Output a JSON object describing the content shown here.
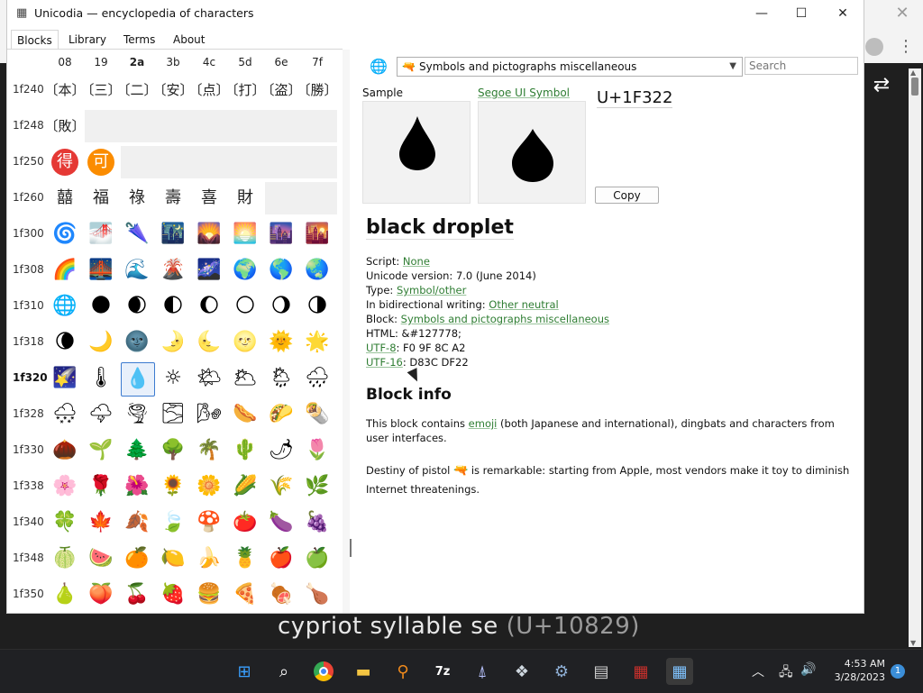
{
  "window": {
    "title": "Unicodia — encyclopedia of characters",
    "minimize": "—",
    "maximize": "☐",
    "close": "✕"
  },
  "tabs": [
    "Blocks",
    "Library",
    "Terms",
    "About"
  ],
  "grid": {
    "columns": [
      "08",
      "19",
      "2a",
      "3b",
      "4c",
      "5d",
      "6e",
      "7f"
    ],
    "rows": [
      {
        "label": "1f240",
        "cells": [
          "〔本〕",
          "〔三〕",
          "〔二〕",
          "〔安〕",
          "〔点〕",
          "〔打〕",
          "〔盗〕",
          "〔勝〕"
        ]
      },
      {
        "label": "1f248",
        "cells": [
          "〔敗〕"
        ]
      },
      {
        "label": "1f250",
        "cells": [
          "得",
          "可"
        ]
      },
      {
        "label": "1f260",
        "cells": [
          "囍",
          "福",
          "祿",
          "壽",
          "喜",
          "財"
        ]
      },
      {
        "label": "1f300",
        "cells": [
          "🌀",
          "🌁",
          "🌂",
          "🌃",
          "🌄",
          "🌅",
          "🌆",
          "🌇"
        ]
      },
      {
        "label": "1f308",
        "cells": [
          "🌈",
          "🌉",
          "🌊",
          "🌋",
          "🌌",
          "🌍",
          "🌎",
          "🌏"
        ]
      },
      {
        "label": "1f310",
        "cells": [
          "🌐",
          "🌑",
          "🌒",
          "🌓",
          "🌔",
          "🌕",
          "🌖",
          "🌗"
        ]
      },
      {
        "label": "1f318",
        "cells": [
          "🌘",
          "🌙",
          "🌚",
          "🌛",
          "🌜",
          "🌝",
          "🌞",
          "🌟"
        ]
      },
      {
        "label": "1f320",
        "cells": [
          "🌠",
          "🌡",
          "💧",
          "☼",
          "🌤",
          "🌥",
          "🌦",
          "🌧"
        ]
      },
      {
        "label": "1f328",
        "cells": [
          "🌨",
          "🌩",
          "🌪",
          "🌫",
          "🌬",
          "🌭",
          "🌮",
          "🌯"
        ]
      },
      {
        "label": "1f330",
        "cells": [
          "🌰",
          "🌱",
          "🌲",
          "🌳",
          "🌴",
          "🌵",
          "🌶",
          "🌷"
        ]
      },
      {
        "label": "1f338",
        "cells": [
          "🌸",
          "🌹",
          "🌺",
          "🌻",
          "🌼",
          "🌽",
          "🌾",
          "🌿"
        ]
      },
      {
        "label": "1f340",
        "cells": [
          "🍀",
          "🍁",
          "🍂",
          "🍃",
          "🍄",
          "🍅",
          "🍆",
          "🍇"
        ]
      },
      {
        "label": "1f348",
        "cells": [
          "🍈",
          "🍉",
          "🍊",
          "🍋",
          "🍌",
          "🍍",
          "🍎",
          "🍏"
        ]
      },
      {
        "label": "1f350",
        "cells": [
          "🍐",
          "🍑",
          "🍒",
          "🍓",
          "🍔",
          "🍕",
          "🍖",
          "🍗"
        ]
      }
    ]
  },
  "toolbar": {
    "block_name": "Symbols and pictographs miscellaneous",
    "search_placeholder": "Search"
  },
  "preview": {
    "sample_label": "Sample",
    "font_label": "Segoe UI Symbol",
    "codepoint": "U+1F322",
    "copy_label": "Copy",
    "glyph": "💧"
  },
  "info": {
    "name": "black droplet",
    "script_label": "Script:",
    "script_value": "None",
    "version_label": "Unicode version:",
    "version_value": "7.0 (June 2014)",
    "type_label": "Type:",
    "type_value": "Symbol/other",
    "bidi_label": "In bidirectional writing:",
    "bidi_value": "Other neutral",
    "block_label": "Block:",
    "block_value": "Symbols and pictographs miscellaneous",
    "html_label": "HTML:",
    "html_value": "&#127778;",
    "utf8_label": "UTF-8",
    "utf8_value": ": F0 9F 8C A2",
    "utf16_label": "UTF-16",
    "utf16_value": ": D83C DF22",
    "block_info_title": "Block info",
    "para1_a": "This block contains ",
    "para1_link": "emoji",
    "para1_b": " (both Japanese and international), dingbats and characters from user interfaces.",
    "para2_a": "Destiny of pistol ",
    "para2_b": " is remarkable: starting from Apple, most vendors make it toy to diminish Internet threatenings."
  },
  "caption": {
    "name": "cypriot syllable se ",
    "code": "(U+10829)"
  },
  "taskbar": {
    "time": "4:53 AM",
    "date": "3/28/2023",
    "notifications": "1"
  }
}
